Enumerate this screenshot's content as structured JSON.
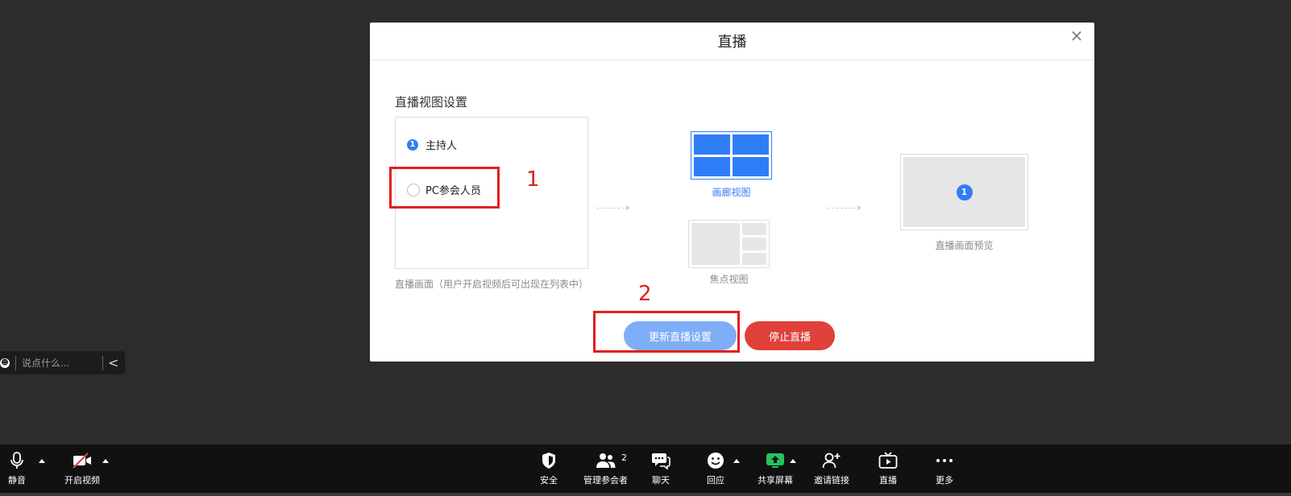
{
  "dialog": {
    "title": "直播",
    "close_glyph": "×",
    "section_title": "直播视图设置",
    "host": {
      "badge": "1",
      "label": "主持人"
    },
    "pc_participants_label": "PC参会人员",
    "hint": "直播画面（用户开启视频后可出现在列表中）",
    "gallery_view_label": "画廊视图",
    "focus_view_label": "焦点视图",
    "preview": {
      "badge": "1",
      "label": "直播画面预览"
    },
    "update_button": "更新直播设置",
    "stop_button": "停止直播"
  },
  "annotations": {
    "box1_number": "1",
    "box2_number": "2"
  },
  "chat": {
    "placeholder": "说点什么...",
    "emoji_icon": "emoji-icon",
    "collapse_glyph": "<"
  },
  "toolbar": {
    "mute": "静音",
    "video": "开启视频",
    "security": "安全",
    "participants": "管理参会者",
    "participants_count": "2",
    "chat": "聊天",
    "react": "回应",
    "share": "共享屏幕",
    "invite": "邀请链接",
    "live": "直播",
    "more": "更多"
  },
  "colors": {
    "accent_blue": "#2f7df6",
    "update_button": "#7eaef7",
    "stop_button": "#e0403a",
    "share_green": "#22c55e",
    "annotation_red": "#e02020"
  }
}
